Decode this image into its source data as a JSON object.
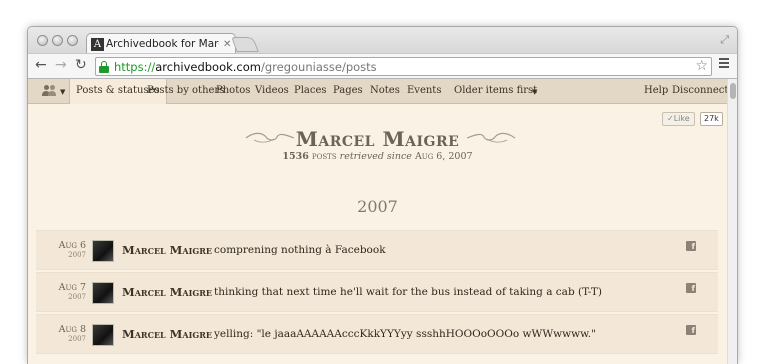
{
  "browser": {
    "tab_title": "Archivedbook for Marcel Ma",
    "tab_favicon": "A",
    "url_scheme": "https://",
    "url_host": "archivedbook.com",
    "url_path": "/gregouniasse/posts"
  },
  "nav": {
    "items": [
      "Posts & statuses",
      "Posts by others",
      "Photos",
      "Videos",
      "Places",
      "Pages",
      "Notes",
      "Events"
    ],
    "order_label": "Older items first",
    "help": "Help",
    "disconnect": "Disconnect"
  },
  "like": {
    "label": "✓Like",
    "count": "27k"
  },
  "profile": {
    "name": "Marcel Maigre",
    "post_count": "1536",
    "posts_word": "posts",
    "retrieved": "retrieved since",
    "since_date": "Aug 6, 2007"
  },
  "year": "2007",
  "posts": [
    {
      "date": "Aug 6",
      "year": "2007",
      "author": "Marcel Maigre",
      "text": "comprening nothing à Facebook"
    },
    {
      "date": "Aug 7",
      "year": "2007",
      "author": "Marcel Maigre",
      "text": "thinking that next time he'll wait for the bus instead of taking a cab (T-T)"
    },
    {
      "date": "Aug 8",
      "year": "2007",
      "author": "Marcel Maigre",
      "text": "yelling: \"le jaaaAAAAAAcccKkkYYYyy ssshhHOOOoOOOo wWWwwww.\""
    }
  ],
  "icons": {
    "back": "back-arrow-icon",
    "forward": "forward-arrow-icon",
    "reload": "reload-icon",
    "lock": "lock-icon",
    "star": "star-icon",
    "menu": "menu-icon",
    "people": "people-icon",
    "facebook": "facebook-icon"
  },
  "colors": {
    "page_bg": "#fbf2e6",
    "nav_bg": "#e3d8c6",
    "row_bg": "#f3e8d7",
    "secure_green": "#1f9a2a"
  }
}
